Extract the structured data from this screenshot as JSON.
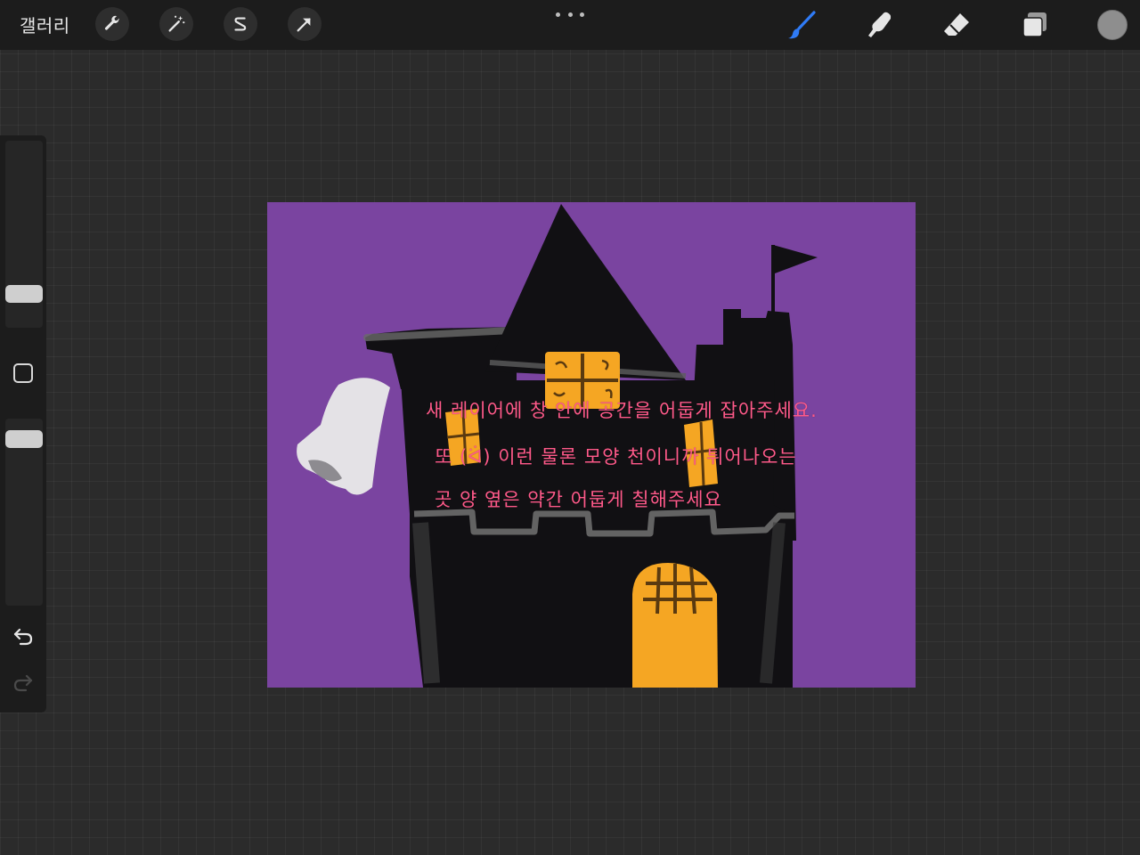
{
  "toolbar": {
    "gallery_label": "갤러리",
    "left_tools": [
      {
        "name": "actions",
        "icon": "wrench-icon"
      },
      {
        "name": "adjustments",
        "icon": "magic-wand-icon"
      },
      {
        "name": "selection",
        "icon": "selection-s-icon"
      },
      {
        "name": "transform",
        "icon": "arrow-cursor-icon"
      }
    ],
    "more_icon": "ellipsis-icon",
    "right_tools": [
      {
        "name": "brush",
        "icon": "brush-icon",
        "active": true
      },
      {
        "name": "smudge",
        "icon": "smudge-finger-icon",
        "active": false
      },
      {
        "name": "eraser",
        "icon": "eraser-icon",
        "active": false
      },
      {
        "name": "layers",
        "icon": "layers-icon",
        "active": false
      }
    ],
    "current_color": "#8e8e8e",
    "active_color": "#2f7bf6"
  },
  "sidebar": {
    "brush_size_level": 0.15,
    "opacity_level": 0.93,
    "modify_icon": "square-icon",
    "undo_icon": "undo-icon",
    "redo_icon": "redo-icon"
  },
  "canvas": {
    "background_color": "#7a44a0",
    "castle_color": "#111013",
    "window_color": "#f5a623",
    "ghost_color": "#e4e2e6",
    "note_color": "#ff5a8a",
    "note_lines": [
      "새 레이어에 창 안에 공간을 어둡게 잡아주세요.",
      "또 (ᐛ) 이런 물론 모양 천이니까 튀어나오는",
      "곳 양 옆은 약간 어둡게 칠해주세요"
    ]
  }
}
